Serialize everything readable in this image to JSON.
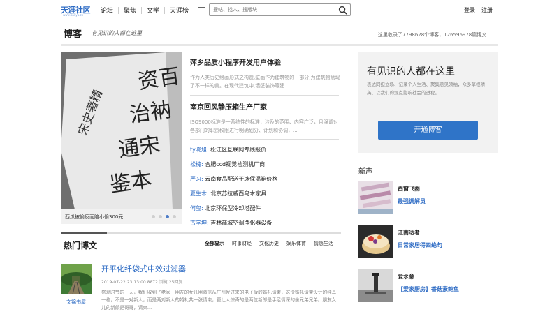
{
  "header": {
    "logo_text": "天涯社区",
    "logo_sub": "www.tianya.cn",
    "nav": [
      "论坛",
      "聚焦",
      "文学",
      "天涯榜"
    ],
    "search_placeholder": "搜帖、找人、搜版块",
    "login": "登录",
    "register": "注册"
  },
  "page": {
    "title": "博客",
    "slogan": "有见识的人都在这里",
    "stats": "这里收录了7798628个博客，126596978篇博文"
  },
  "slider": {
    "caption": "西瓜被偷反而赔小偷300元",
    "image_text_lines": [
      "资百",
      "治衲",
      "通宋",
      "鉴本"
    ],
    "image_text_side": "宋史著精",
    "dots": 4,
    "active_dot": 2
  },
  "articles": [
    {
      "title": "萍乡品质小程序开发用户体验",
      "summary": "作为人类历史绘画形式之构造,壁画作为建筑物的一部分,为建筑物赋现了不一样的美。在现代建筑中,墙壁装饰等建..."
    },
    {
      "title": "南京回风静压箱生产厂家",
      "summary": "ISO9000标准是一系统性的标准，涉及的范围、内容广泛，且强调对各部门的职责权限进行明确划分、计划和协调，..."
    }
  ],
  "people": [
    {
      "name": "ty晓旭:",
      "text": "松江区互联网专线报价"
    },
    {
      "name": "松槐:",
      "text": "合肥ccd视觉检测机厂商"
    },
    {
      "name": "严习:",
      "text": "云南食品配送干冰保温箱价格"
    },
    {
      "name": "夏生木:",
      "text": "北京苏拉威西乌木家具"
    },
    {
      "name": "何玺:",
      "text": "北京环保型冷却塔配件"
    },
    {
      "name": "古学坤:",
      "text": "吉林商城空调净化器设备"
    }
  ],
  "hot": {
    "title": "热门博文",
    "tabs": [
      "全部显示",
      "时事财经",
      "文化历史",
      "娱乐体育",
      "情感生活"
    ],
    "active_tab": 0,
    "post": {
      "title": "开平化纤袋式中效过滤器",
      "meta": "2019-07-22 23:13:00 8872 浏览 25回复",
      "text": "盛夏时节的一天，我们收到了老家一朋友的女儿用微信从广州发过来的电子版的婚礼请柬，这份婚礼请柬设计的独具一格，不是一对新人，而是两对新人的婚礼共一张请柬，更让人惊奇的是两位新郎是手足情深的亲兄弟兄弟。朋友女儿的新郎是哥哥，请柬...",
      "author": "文锦书屋"
    }
  },
  "promo": {
    "title": "有见识的人都在这里",
    "text": "表达同担立场、记录个人生活、聚集意见领袖，众多草根精英，以我们的观点影响社会的进程。",
    "button": "开通博客"
  },
  "xinsheng": {
    "title": "新声",
    "items": [
      {
        "user": "西窗飞雨",
        "desc": "最强调解员"
      },
      {
        "user": "江南达者",
        "desc": "日常家居得四绝句"
      },
      {
        "user": "爱水意",
        "desc": "【爱家厨房】香菇素鲍鱼"
      }
    ]
  },
  "colors": {
    "link_blue": "#2d6bc4",
    "button_blue": "#2f74c8",
    "active_dot": "#4d7cc7"
  }
}
